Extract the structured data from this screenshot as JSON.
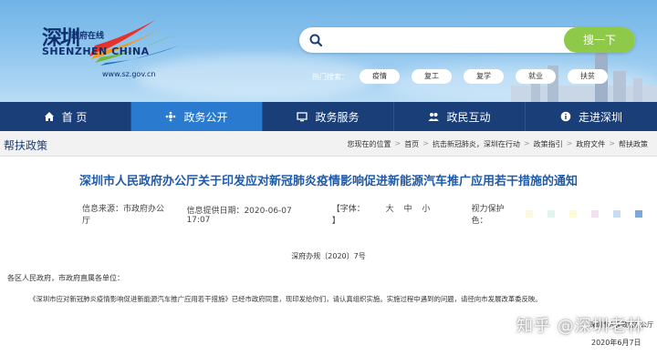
{
  "header": {
    "logo_cn": "深圳",
    "logo_sub": "政府在线",
    "logo_en": "SHENZHEN CHINA",
    "logo_url": "www.sz.gov.cn",
    "search_placeholder": "",
    "search_button": "搜一下",
    "hot_label": "热门搜索：",
    "hot_tags": [
      "疫情",
      "复工",
      "复学",
      "就业",
      "扶贫"
    ]
  },
  "nav": {
    "items": [
      {
        "label": "首  页",
        "icon": "home-icon"
      },
      {
        "label": "政务公开",
        "icon": "open-affairs-icon"
      },
      {
        "label": "政务服务",
        "icon": "monitor-icon"
      },
      {
        "label": "政民互动",
        "icon": "people-icon"
      },
      {
        "label": "走进深圳",
        "icon": "info-icon"
      }
    ],
    "active_index": 1
  },
  "breadcrumb": {
    "section_title": "帮扶政策",
    "location_label": "您现在的位置",
    "items": [
      "首页",
      "抗击新冠肺炎，深圳在行动",
      "政策指引",
      "政府文件",
      "帮扶政策"
    ]
  },
  "article": {
    "title": "深圳市人民政府办公厅关于印发应对新冠肺炎疫情影响促进新能源汽车推广应用若干措施的通知",
    "source": "信息来源：市政府办公厅",
    "date": "信息提供日期：2020-06-07 17:07",
    "font_label": "【字体：",
    "font_big": "大",
    "font_mid": "中",
    "font_small": "小",
    "font_close": "】",
    "vision_label": "视力保护色：",
    "vision_colors": [
      "#fff9e0",
      "#e0f5f0",
      "#fffbd6",
      "#f5e0f0",
      "#c8dcf5",
      "#7ea7dc"
    ],
    "doc_number": "深府办规〔2020〕7号",
    "salutation": "各区人民政府，市政府直属各单位：",
    "body": "《深圳市应对新冠肺炎疫情影响促进新能源汽车推广应用若干措施》已经市政府同意，现印发给你们，请认真组织实施。实施过程中遇到的问题，请径向市发展改革委反映。",
    "sign_org": "深圳市人民政府办公厅",
    "sign_date": "2020年6月7日"
  },
  "watermark": "知乎 @深圳老林",
  "colors": {
    "nav_bg": "#1a3e78",
    "nav_active": "#2a7bd0",
    "title": "#1e5aa8",
    "search_button": "#8fc94a"
  }
}
